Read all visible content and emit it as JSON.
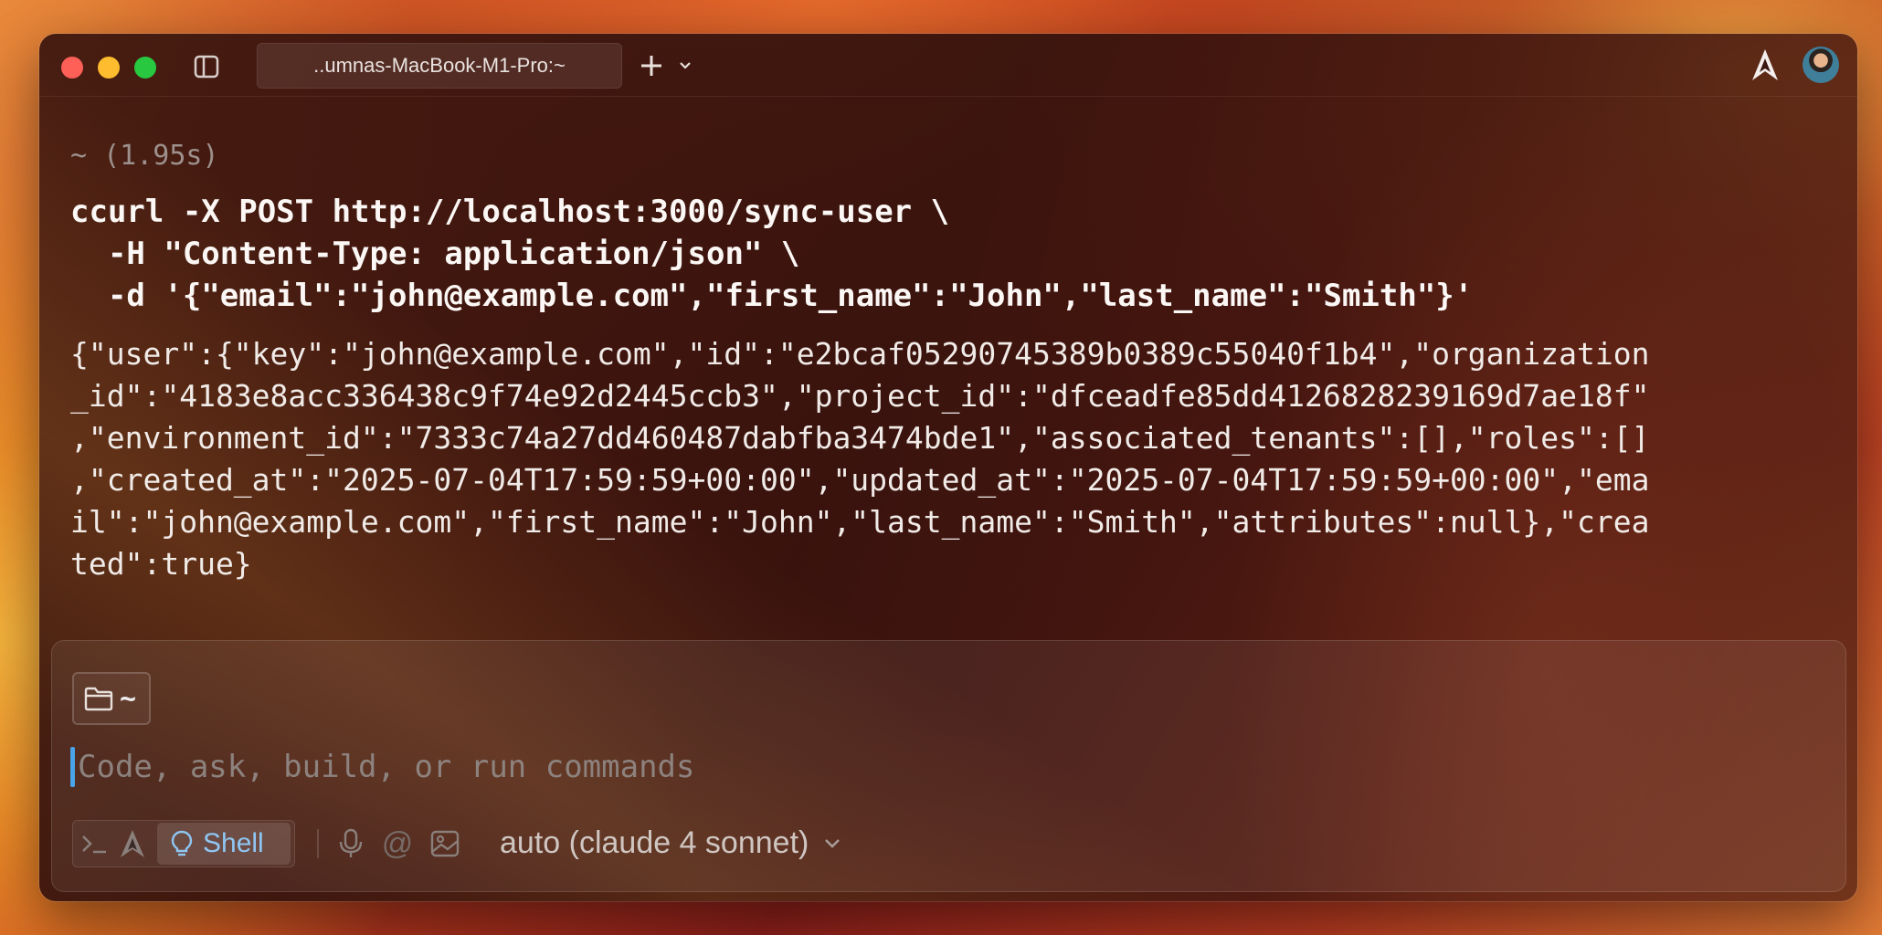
{
  "window": {
    "tab_title": "..umnas-MacBook-M1-Pro:~"
  },
  "terminal": {
    "prompt": "~   (1.95s)",
    "command": "ccurl -X POST http://localhost:3000/sync-user \\\n  -H \"Content-Type: application/json\" \\\n  -d '{\"email\":\"john@example.com\",\"first_name\":\"John\",\"last_name\":\"Smith\"}'",
    "output": "{\"user\":{\"key\":\"john@example.com\",\"id\":\"e2bcaf05290745389b0389c55040f1b4\",\"organization\n_id\":\"4183e8acc336438c9f74e92d2445ccb3\",\"project_id\":\"dfceadfe85dd4126828239169d7ae18f\"\n,\"environment_id\":\"7333c74a27dd460487dabfba3474bde1\",\"associated_tenants\":[],\"roles\":[]\n,\"created_at\":\"2025-07-04T17:59:59+00:00\",\"updated_at\":\"2025-07-04T17:59:59+00:00\",\"ema\nil\":\"john@example.com\",\"first_name\":\"John\",\"last_name\":\"Smith\",\"attributes\":null},\"crea\nted\":true}"
  },
  "composer": {
    "directory": "~",
    "placeholder": "Code, ask, build, or run commands",
    "value": "",
    "mode_label": "Shell",
    "at_symbol": "@",
    "model_label": "auto (claude 4 sonnet)"
  },
  "icons": {
    "sidebar": "sidebar-toggle-icon",
    "new_tab": "plus-icon",
    "tab_menu": "chevron-down-icon",
    "agent": "agent-logo-icon",
    "folder": "folder-icon",
    "terminal_mode": "terminal-prompt-icon",
    "shell_mode": "lightbulb-icon",
    "mic": "microphone-icon",
    "image": "image-icon"
  },
  "colors": {
    "accent": "#8fc6f3",
    "caret": "#4aa3e8",
    "close": "#fe5f57",
    "minimize": "#febc2e",
    "zoom": "#28c840"
  }
}
